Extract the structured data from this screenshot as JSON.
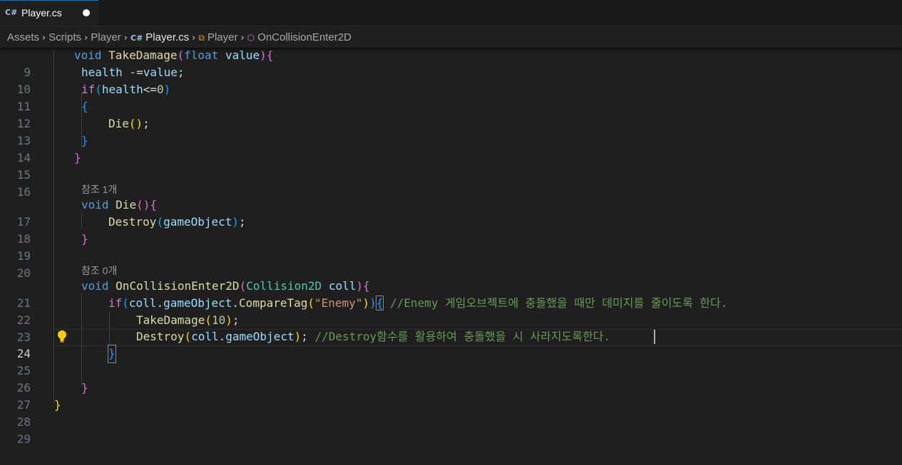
{
  "tab": {
    "filename": "Player.cs",
    "icon": "csharp-file-icon"
  },
  "breadcrumb": {
    "items": [
      "Assets",
      "Scripts",
      "Player",
      "Player.cs",
      "Player",
      "OnCollisionEnter2D"
    ],
    "icons": {
      "file": "csharp-file-icon",
      "class": "class-icon",
      "method": "method-icon"
    }
  },
  "editor": {
    "active_line": "24",
    "lines": [
      {
        "n": "9",
        "code": "void TakeDamage(float value){"
      },
      {
        "n": "10",
        "code": "health -=value;"
      },
      {
        "n": "11",
        "code": "if(health<=0)"
      },
      {
        "n": "12",
        "code": "{"
      },
      {
        "n": "13",
        "code": "Die();"
      },
      {
        "n": "14",
        "code": "}"
      },
      {
        "n": "15",
        "code": "}"
      },
      {
        "n": "16",
        "code": ""
      },
      {
        "n": "17",
        "code": "void Die(){"
      },
      {
        "n": "18",
        "code": "Destroy(gameObject);"
      },
      {
        "n": "19",
        "code": "}"
      },
      {
        "n": "20",
        "code": ""
      },
      {
        "n": "21",
        "code": "void OnCollisionEnter2D(Collision2D coll){"
      },
      {
        "n": "22",
        "code": "if(coll.gameObject.CompareTag(\"Enemy\")){ //Enemy 게임오브젝트에 충돌했을 때만 데미지를 줄이도록 한다."
      },
      {
        "n": "23",
        "code": "TakeDamage(10);"
      },
      {
        "n": "24",
        "code": "Destroy(coll.gameObject); //Destroy함수를 활용하여 충돌했을 시 사라지도록한다."
      },
      {
        "n": "25",
        "code": "}"
      },
      {
        "n": "26",
        "code": ""
      },
      {
        "n": "27",
        "code": "}"
      },
      {
        "n": "28",
        "code": "}"
      },
      {
        "n": "29",
        "code": ""
      }
    ],
    "codelens": {
      "die_refs": "참조 1개",
      "collision_refs": "참조 0개"
    }
  },
  "colors": {
    "keyword": "#569cd6",
    "control": "#c586c0",
    "function": "#dcdcaa",
    "variable": "#9cdcfe",
    "type": "#4ec9b0",
    "number": "#b5cea8",
    "string": "#ce9178",
    "comment": "#6a9955",
    "bracket1": "#ffd700",
    "bracket2": "#da70d6",
    "bracket3": "#179fff"
  }
}
